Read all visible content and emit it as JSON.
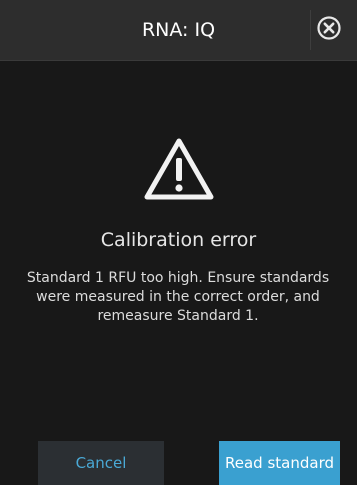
{
  "header": {
    "title": "RNA: IQ",
    "close_icon": "close-circle-icon"
  },
  "dialog": {
    "icon": "warning-triangle-icon",
    "title": "Calibration error",
    "message": "Standard 1 RFU too high. Ensure standards were measured in the correct order, and remeasure Standard 1."
  },
  "actions": {
    "cancel_label": "Cancel",
    "read_standard_label": "Read standard"
  },
  "colors": {
    "background": "#181818",
    "header": "#2d2d2d",
    "accent": "#3aa0d0"
  }
}
